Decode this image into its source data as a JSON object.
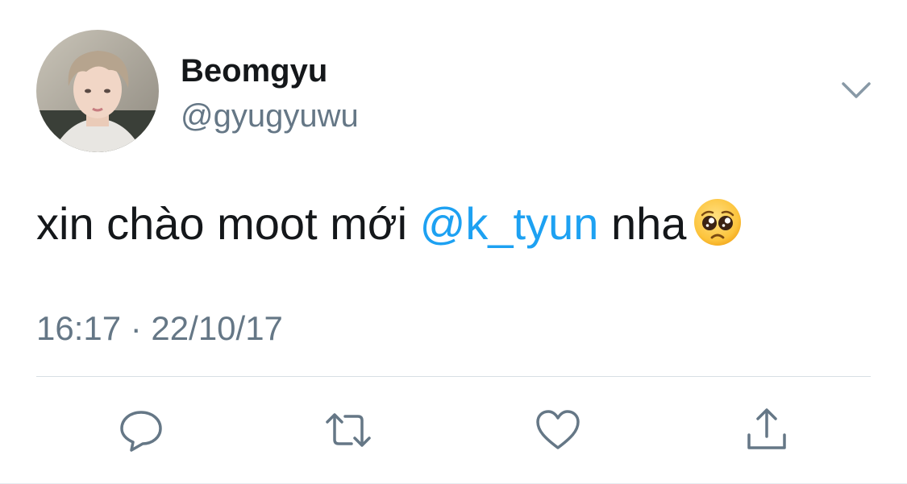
{
  "tweet": {
    "author": {
      "display_name": "Beomgyu",
      "handle": "@gyugyuwu"
    },
    "text": {
      "before_mention": "xin chào moot mới ",
      "mention": "@k_tyun",
      "after_mention": " nha"
    },
    "emoji": "pleading-face-emoji",
    "timestamp": "16:17 · 22/10/17"
  },
  "actions": [
    "reply-icon",
    "retweet-icon",
    "like-icon",
    "share-icon"
  ],
  "colors": {
    "text": "#14171a",
    "secondary": "#657786",
    "accent": "#1da1f2",
    "divider": "#d8dfe4"
  }
}
